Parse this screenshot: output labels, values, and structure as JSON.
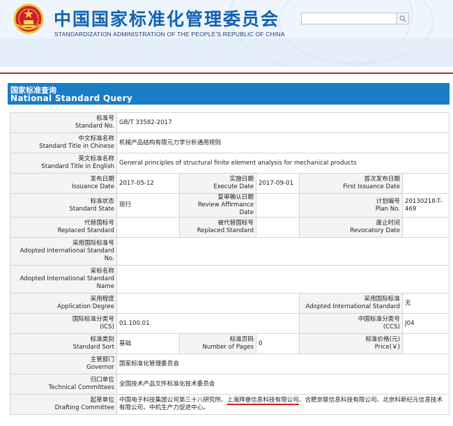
{
  "header": {
    "title_cn": "中国国家标准化管理委员会",
    "title_en": "STANDARDIZATION ADMINISTRATION OF THE PEOPLE'S REPUBLIC OF CHINA",
    "search_placeholder": "",
    "search_icon": "search-icon",
    "emblem_icon": "national-emblem-icon"
  },
  "banner": {
    "title_cn": "国家标准查询",
    "title_en": "National Standard Query"
  },
  "colors": {
    "banner": "#1b7cc6",
    "title": "#1262b1",
    "red_line": "#b22a2a",
    "label_bg": "#f4f4f4",
    "plan_link": "#1a5fb0"
  },
  "fields": {
    "standard_no": {
      "cn": "标准号",
      "en": "Standard No.",
      "value": "GB/T 33582-2017"
    },
    "title_cn": {
      "cn": "中文标准名称",
      "en": "Standard Title in Chinese",
      "value": "机械产品结构有限元力学分析通用规则"
    },
    "title_en": {
      "cn": "英文标准名称",
      "en": "Standard Title in English",
      "value": "General principles of structural finite element analysis for mechanical products"
    },
    "issuance_date": {
      "cn": "发布日期",
      "en": "Issuance Date",
      "value": "2017-05-12"
    },
    "execute_date": {
      "cn": "实施日期",
      "en": "Execute Date",
      "value": "2017-09-01"
    },
    "first_issuance": {
      "cn": "首次发布日期",
      "en": "First Issuance Date",
      "value": ""
    },
    "standard_state": {
      "cn": "标准状态",
      "en": "Standard State",
      "value": "现行"
    },
    "review_date": {
      "cn": "复审确认日期",
      "en": "Review Affirmance Date",
      "value": ""
    },
    "plan_no": {
      "cn": "计划编号",
      "en": "Plan No.",
      "value": "20130218-T-469"
    },
    "replaced": {
      "cn": "代替国标号",
      "en": "Replaced Standard",
      "value": ""
    },
    "replaced_by": {
      "cn": "被代替国标号",
      "en": "Replaced Standard",
      "value": ""
    },
    "revocatory": {
      "cn": "废止时间",
      "en": "Revocatory Date",
      "value": ""
    },
    "adopted_intl_no": {
      "cn": "采用国际标准号",
      "en": "Adopted International Standard No.",
      "value": ""
    },
    "adopted_intl_name": {
      "cn": "采标名称",
      "en": "Adopted International Standard Name",
      "value": ""
    },
    "app_degree": {
      "cn": "采用程度",
      "en": "Application Degree",
      "value": ""
    },
    "adopted_intl": {
      "cn": "采用国际标准",
      "en": "Adopted International Standard",
      "value": "无"
    },
    "ics": {
      "cn": "国际标准分类号",
      "en": "(ICS)",
      "value": "01.100.01"
    },
    "ccs": {
      "cn": "中国标准分类号",
      "en": "(CCS)",
      "value": "J04"
    },
    "sort": {
      "cn": "标准类别",
      "en": "Standard Sort",
      "value": "基础"
    },
    "pages": {
      "cn": "标准页码",
      "en": "Number of Pages",
      "value": "0"
    },
    "price": {
      "cn": "标准价格(元)",
      "en": "Price(￥)",
      "value": ""
    },
    "governor": {
      "cn": "主管部门",
      "en": "Governor",
      "value": "国家标准化管理委员会"
    },
    "tech_committees": {
      "cn": "归口单位",
      "en": "Technical Committees",
      "value": "全国技术产品文件标准化技术委员会"
    },
    "drafting": {
      "cn": "起草单位",
      "en": "Drafting Committee",
      "part1": "中国电子科技集团公司第三十八研究所、",
      "part2": "上海拜睿信息科技有限公司",
      "part3": "、合肥京联信息科技有限公司、北京科新纪元信息技术有限公司、中机生产力促进中心。"
    }
  }
}
